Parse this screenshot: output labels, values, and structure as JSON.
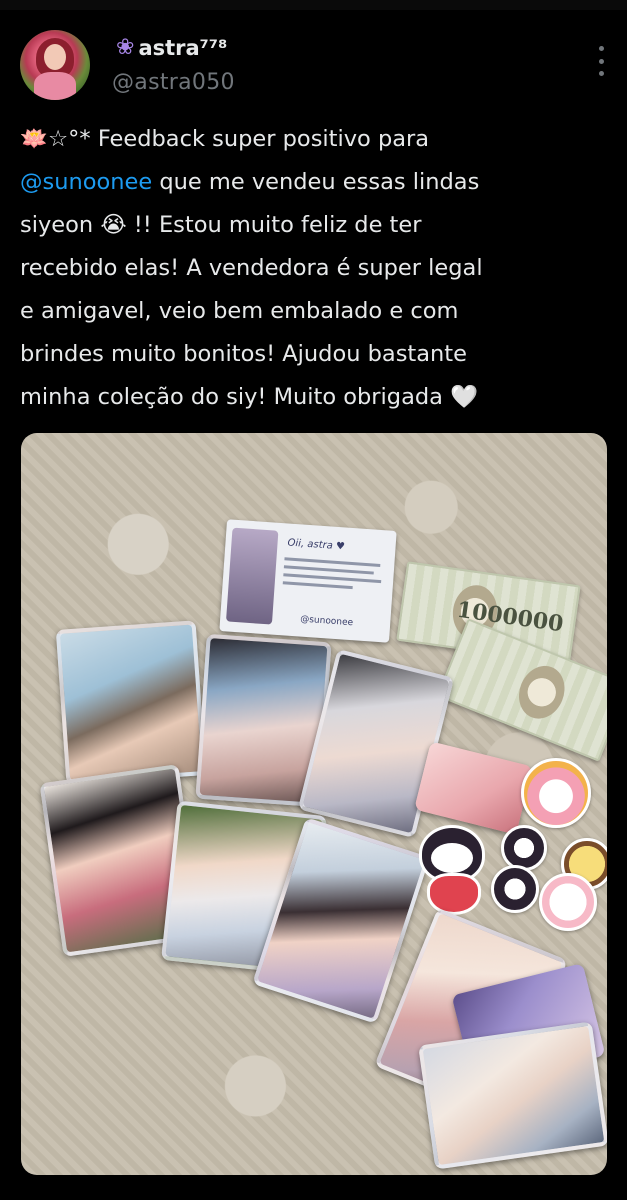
{
  "user": {
    "display_name": "astra⁷⁷⁸",
    "handle": "@astra050",
    "name_emoji": "hyacinth-icon"
  },
  "tweet": {
    "line1_prefix": "🪷☆°* Feedback super positivo para",
    "mention": "@sunoonee",
    "line2_suffix": " que me vendeu essas lindas",
    "line3": "siyeon 😭 !! Estou muito feliz de ter",
    "line4": "recebido elas! A vendedora é super legal",
    "line5": "e amigavel, veio bem embalado e com",
    "line6": "brindes muito bonitos! Ajudou bastante",
    "line7": "minha coleção do siy! Muito obrigada 🤍"
  },
  "media": {
    "letter_greeting": "Oii, astra ♥",
    "letter_signature": "@sunoonee",
    "bill_value": "1000000"
  },
  "colors": {
    "background": "#000000",
    "text": "#e7e9ea",
    "secondary": "#71767b",
    "link": "#1d9bf0"
  }
}
